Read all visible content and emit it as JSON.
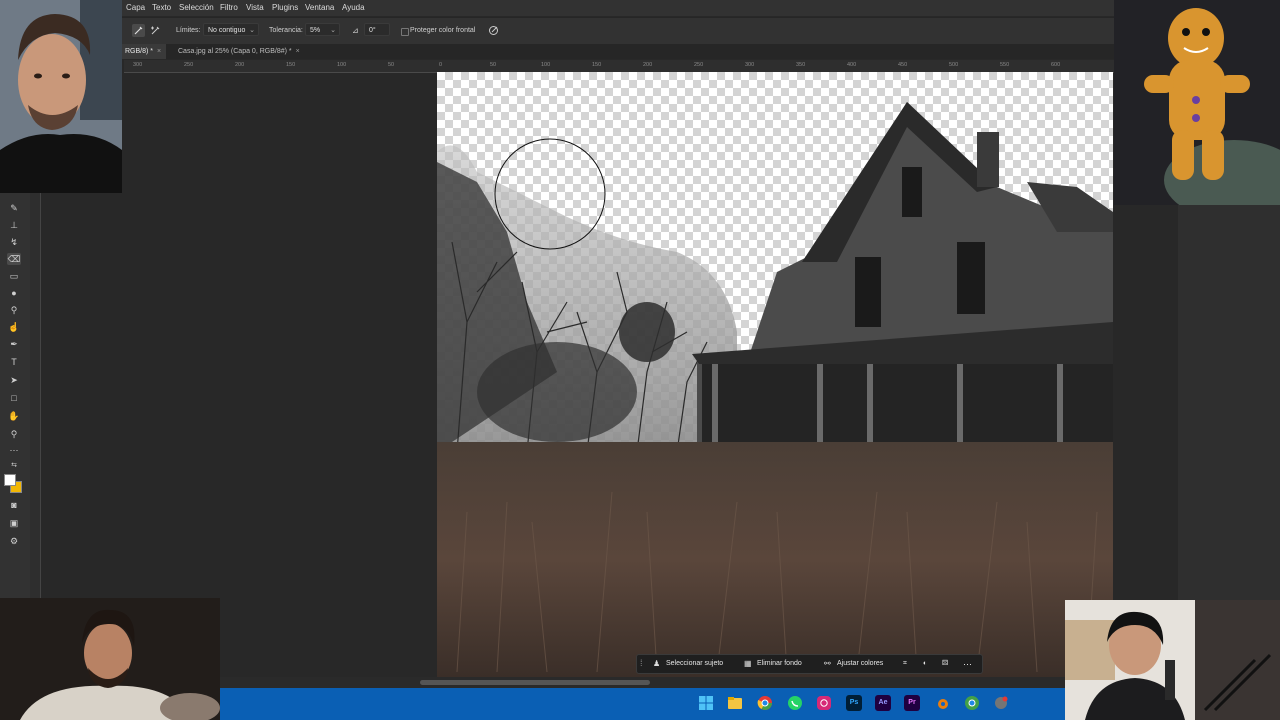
{
  "menu": {
    "items": [
      "Capa",
      "Texto",
      "Selección",
      "Filtro",
      "Vista",
      "Plugins",
      "Ventana",
      "Ayuda"
    ]
  },
  "options": {
    "limits_label": "Límites:",
    "limits_value": "No contiguo",
    "tolerance_label": "Tolerancia:",
    "tolerance_value": "5%",
    "angle_value": "0°",
    "protect_label": "Proteger color frontal"
  },
  "tabs": [
    {
      "label": "RGB/8) *",
      "active": true
    },
    {
      "label": "Casa.jpg al 25% (Capa 0, RGB/8#) *",
      "active": false
    }
  ],
  "ruler": {
    "ticks": [
      "300",
      "250",
      "200",
      "150",
      "100",
      "50",
      "0",
      "50",
      "100",
      "150",
      "200",
      "250",
      "300",
      "350",
      "400",
      "450",
      "500",
      "550",
      "600"
    ]
  },
  "context_bar": {
    "select_subject": "Seleccionar sujeto",
    "remove_bg": "Eliminar fondo",
    "adjust_colors": "Ajustar colores"
  },
  "taskbar": {
    "apps": [
      {
        "name": "windows-start-icon",
        "color": "#4fc3f7",
        "text": ""
      },
      {
        "name": "file-explorer-icon",
        "color": "#f4c542",
        "text": ""
      },
      {
        "name": "chrome-icon",
        "color": "#e53935",
        "text": ""
      },
      {
        "name": "whatsapp-icon",
        "color": "#25d366",
        "text": ""
      },
      {
        "name": "instagram-icon",
        "color": "#d62976",
        "text": ""
      },
      {
        "name": "photoshop-icon",
        "color": "#001e36",
        "text": "Ps"
      },
      {
        "name": "after-effects-icon",
        "color": "#1f0040",
        "text": "Ae"
      },
      {
        "name": "premiere-icon",
        "color": "#1f0040",
        "text": "Pr"
      },
      {
        "name": "blender-icon",
        "color": "#e87d0d",
        "text": ""
      },
      {
        "name": "chrome-alt-icon",
        "color": "#43a047",
        "text": ""
      },
      {
        "name": "app-icon",
        "color": "#757575",
        "text": ""
      }
    ]
  },
  "colors": {
    "foreground": "#ffffff",
    "background": "#f2b705",
    "taskbar": "#0a5fb4",
    "ui_dark": "#323232"
  }
}
